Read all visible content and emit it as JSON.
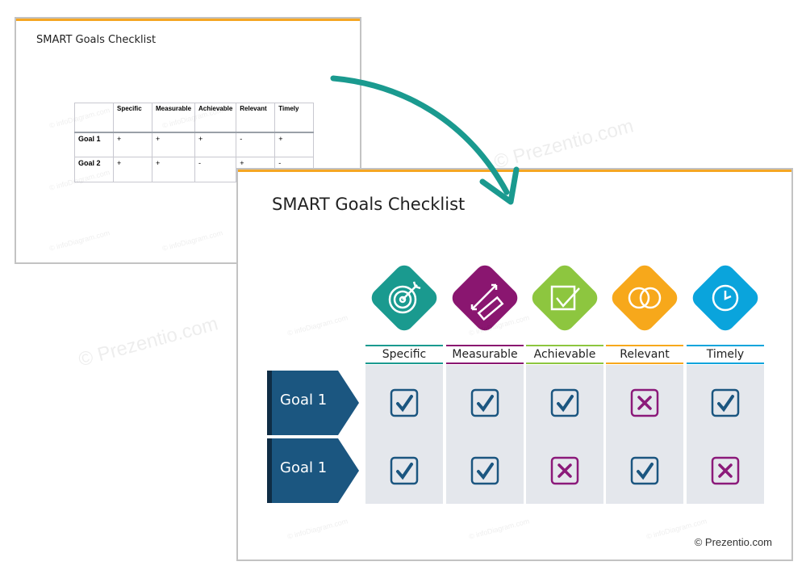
{
  "old_slide": {
    "title": "SMART Goals Checklist",
    "columns": [
      "",
      "Specific",
      "Measurable",
      "Achievable",
      "Relevant",
      "Timely"
    ],
    "rows": [
      {
        "label": "Goal 1",
        "values": [
          "+",
          "+",
          "+",
          "-",
          "+"
        ]
      },
      {
        "label": "Goal 2",
        "values": [
          "+",
          "+",
          "-",
          "+",
          "-"
        ]
      }
    ],
    "watermark": "© infoDiagram.com"
  },
  "new_slide": {
    "title": "SMART Goals Checklist",
    "criteria": [
      {
        "label": "Specific",
        "icon": "target-icon",
        "color": "#1a9a8f"
      },
      {
        "label": "Measurable",
        "icon": "ruler-icon",
        "color": "#8a1670"
      },
      {
        "label": "Achievable",
        "icon": "checkbox-icon",
        "color": "#8dc63f"
      },
      {
        "label": "Relevant",
        "icon": "rings-icon",
        "color": "#f7a81b"
      },
      {
        "label": "Timely",
        "icon": "clock-icon",
        "color": "#0aa4dc"
      }
    ],
    "goals": [
      {
        "label": "Goal 1",
        "marks": [
          "check",
          "check",
          "check",
          "cross",
          "check"
        ]
      },
      {
        "label": "Goal 1",
        "marks": [
          "check",
          "check",
          "cross",
          "check",
          "cross"
        ]
      }
    ],
    "copyright": "© Prezentio.com",
    "watermark": "© infoDiagram.com"
  },
  "background_watermark": "© Prezentio.com",
  "colors": {
    "accent": "#f5a623",
    "goal": "#1b5680",
    "check": "#1b5680",
    "cross": "#8b1a7a",
    "arrow": "#1a9a8f"
  }
}
